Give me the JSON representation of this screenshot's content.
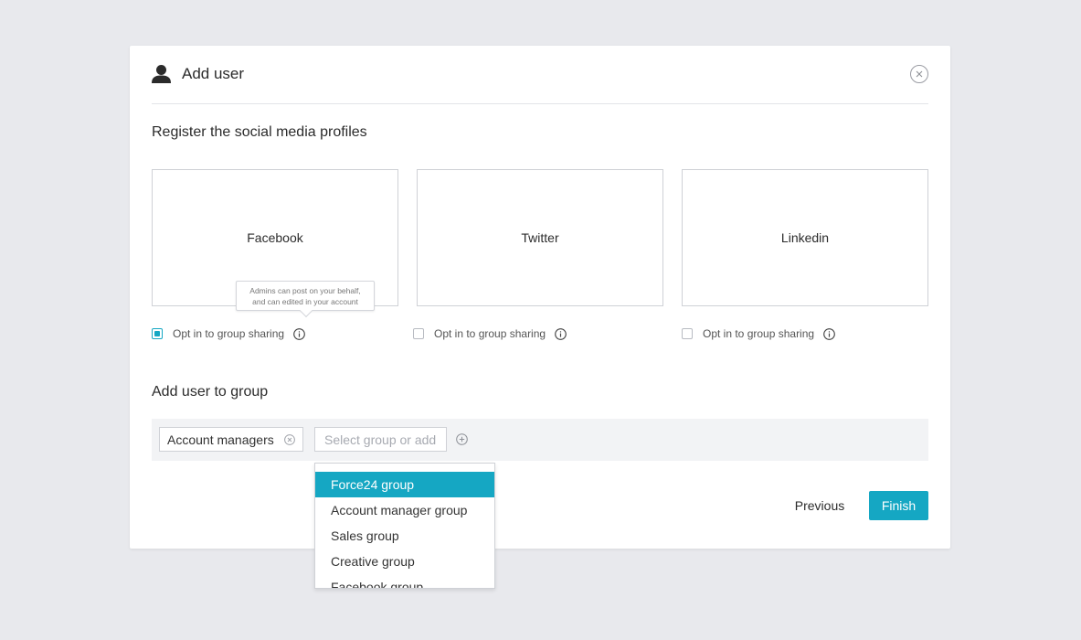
{
  "colors": {
    "accent": "#15a7c3",
    "background": "#e8e9ed",
    "group_bar": "#f2f3f5"
  },
  "modal": {
    "title": "Add user",
    "title_icon": "user-icon",
    "close_icon": "close-icon"
  },
  "social": {
    "title": "Register the social media profiles",
    "profiles": [
      {
        "label": "Facebook",
        "optin_label": "Opt in to group sharing",
        "opted_in": true
      },
      {
        "label": "Twitter",
        "optin_label": "Opt in to group sharing",
        "opted_in": false
      },
      {
        "label": "Linkedin",
        "optin_label": "Opt in to group sharing",
        "opted_in": false
      }
    ],
    "tooltip": {
      "line1": "Admins can post on your behalf,",
      "line2": "and can edited in your account"
    }
  },
  "groups": {
    "title": "Add user to group",
    "selected_chips": [
      "Account managers"
    ],
    "input_placeholder": "Select group or add your own",
    "input_value": "",
    "add_icon": "plus-circle-icon",
    "dropdown_options": [
      "Force24 group",
      "Account manager group",
      "Sales group",
      "Creative group",
      "Facebook group"
    ],
    "active_option_index": 0
  },
  "footer": {
    "previous_label": "Previous",
    "finish_label": "Finish"
  }
}
